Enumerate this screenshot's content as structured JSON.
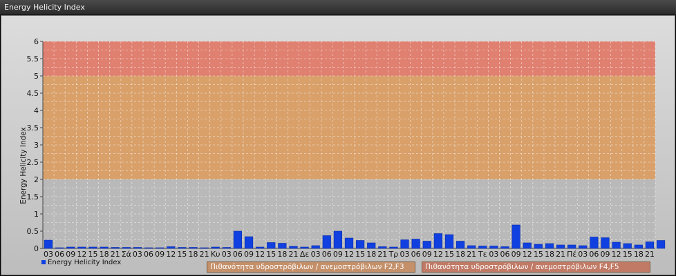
{
  "window": {
    "title": "Energy Helicity Index"
  },
  "legend": {
    "label": "Energy Helicity Index"
  },
  "bands": {
    "f2f3": "Πιθανότητα υδροστρόβιλων / ανεμοστρόβιλων F2,F3",
    "f4f5": "Πιθανότητα υδροστρόβιλων / ανεμοστρόβιλων F4,F5"
  },
  "colors": {
    "bar": "#1040e0",
    "zone_low": "#b9b9b9",
    "zone_mid": "#d9a06a",
    "zone_high": "#e08070"
  },
  "chart_data": {
    "type": "bar",
    "title": "",
    "ylabel": "Energy Helicity Index",
    "xlabel": "",
    "ylim": [
      0,
      6
    ],
    "yticks": [
      "0",
      "0.5",
      "1",
      "1.5",
      "2",
      "2.5",
      "3",
      "3.5",
      "4",
      "4.5",
      "5",
      "5.5",
      "6"
    ],
    "grid": true,
    "legend_position": "bottom-left",
    "zones": [
      {
        "from": 0,
        "to": 2,
        "color": "#b9b9b9"
      },
      {
        "from": 2,
        "to": 5,
        "color": "#d9a06a"
      },
      {
        "from": 5,
        "to": 6,
        "color": "#e08070"
      }
    ],
    "categories": [
      "03",
      "06",
      "09",
      "12",
      "15",
      "18",
      "21",
      "Σά",
      "03",
      "06",
      "09",
      "12",
      "15",
      "18",
      "21",
      "Κυ",
      "03",
      "06",
      "09",
      "12",
      "15",
      "18",
      "21",
      "Δε",
      "03",
      "06",
      "09",
      "12",
      "15",
      "18",
      "21",
      "Τρ",
      "03",
      "06",
      "09",
      "12",
      "15",
      "18",
      "21",
      "Τε",
      "03",
      "06",
      "09",
      "12",
      "15",
      "18",
      "21",
      "Πέ",
      "03",
      "06",
      "09",
      "12",
      "15",
      "18",
      "21"
    ],
    "series": [
      {
        "name": "Energy Helicity Index",
        "values": [
          0.24,
          0.02,
          0.04,
          0.04,
          0.04,
          0.04,
          0.03,
          0.03,
          0.03,
          0.02,
          0.02,
          0.05,
          0.03,
          0.03,
          0.02,
          0.04,
          0.03,
          0.5,
          0.34,
          0.04,
          0.17,
          0.15,
          0.06,
          0.04,
          0.08,
          0.37,
          0.5,
          0.3,
          0.23,
          0.16,
          0.05,
          0.04,
          0.25,
          0.27,
          0.21,
          0.43,
          0.4,
          0.21,
          0.08,
          0.07,
          0.07,
          0.05,
          0.68,
          0.16,
          0.12,
          0.14,
          0.1,
          0.1,
          0.08,
          0.33,
          0.31,
          0.18,
          0.14,
          0.1,
          0.19,
          0.23
        ]
      }
    ]
  }
}
